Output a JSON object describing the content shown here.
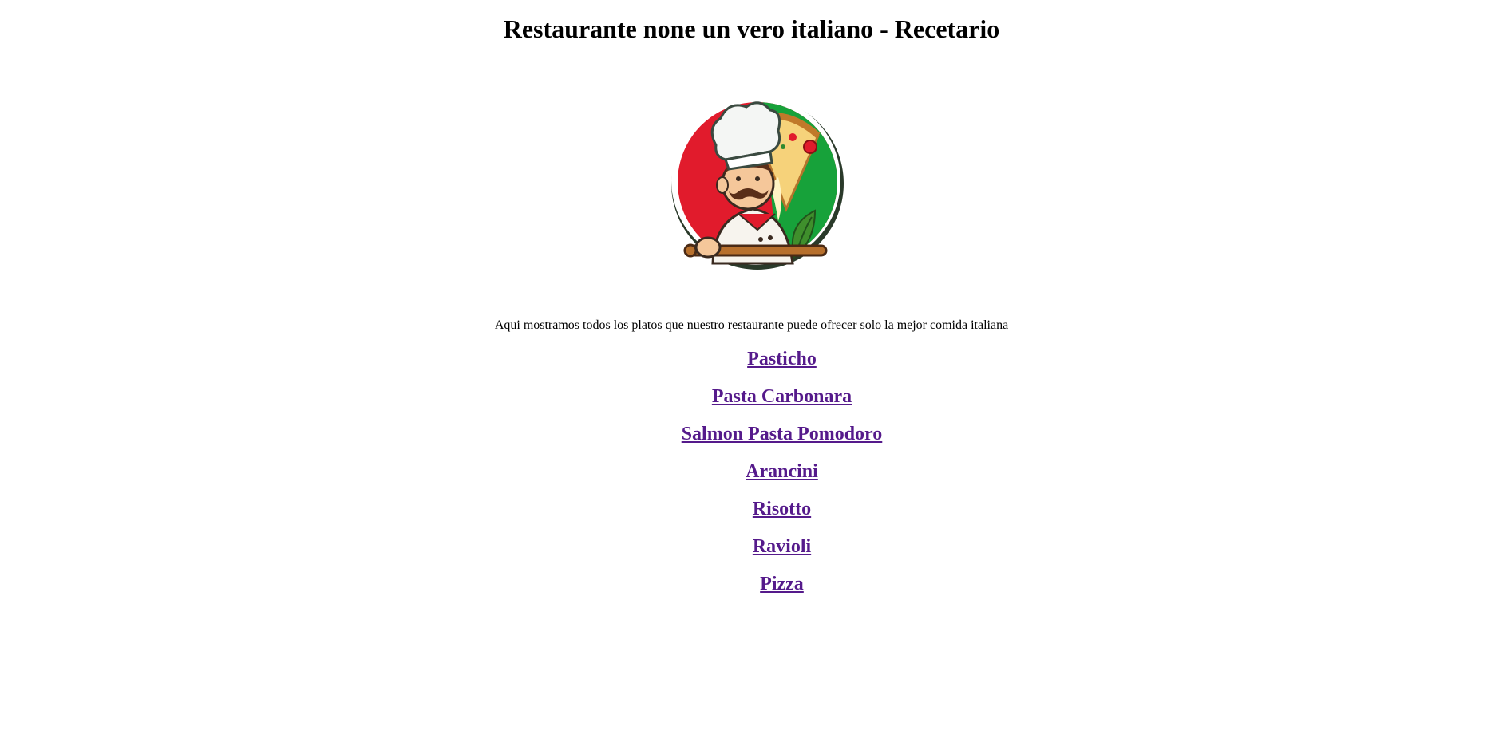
{
  "header": {
    "title": "Restaurante none un vero italiano - Recetario"
  },
  "logo": {
    "icon": "chef-with-pizza-logo",
    "colors": {
      "red": "#e11b2c",
      "green": "#17a23a",
      "cream": "#fdf3df",
      "brown": "#5a2e18"
    }
  },
  "intro": {
    "text": "Aqui mostramos todos los platos que nuestro restaurante puede ofrecer solo la mejor comida italiana"
  },
  "dishes": [
    {
      "label": "Pasticho"
    },
    {
      "label": "Pasta Carbonara"
    },
    {
      "label": "Salmon Pasta Pomodoro"
    },
    {
      "label": "Arancini"
    },
    {
      "label": "Risotto"
    },
    {
      "label": "Ravioli"
    },
    {
      "label": "Pizza"
    }
  ],
  "link_color": "#551a8b"
}
